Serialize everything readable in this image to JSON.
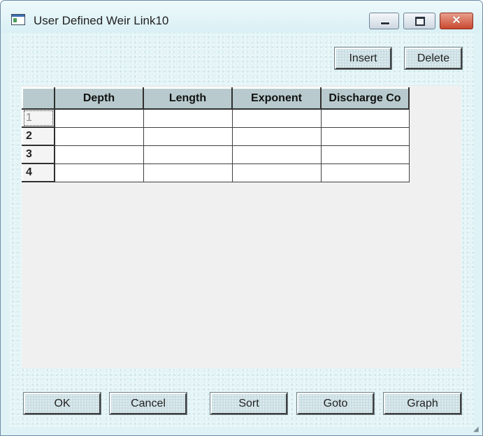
{
  "window": {
    "title": "User Defined Weir Link10",
    "minimize_label": "",
    "maximize_label": "",
    "close_label": "✕"
  },
  "toolbar": {
    "insert_label": "Insert",
    "delete_label": "Delete"
  },
  "table": {
    "columns": [
      "Depth",
      "Length",
      "Exponent",
      "Discharge Co"
    ],
    "rows": [
      {
        "num": "1",
        "cells": [
          "",
          "",
          "",
          ""
        ]
      },
      {
        "num": "2",
        "cells": [
          "",
          "",
          "",
          ""
        ]
      },
      {
        "num": "3",
        "cells": [
          "",
          "",
          "",
          ""
        ]
      },
      {
        "num": "4",
        "cells": [
          "",
          "",
          "",
          ""
        ]
      }
    ]
  },
  "footer": {
    "ok_label": "OK",
    "cancel_label": "Cancel",
    "sort_label": "Sort",
    "goto_label": "Goto",
    "graph_label": "Graph"
  }
}
